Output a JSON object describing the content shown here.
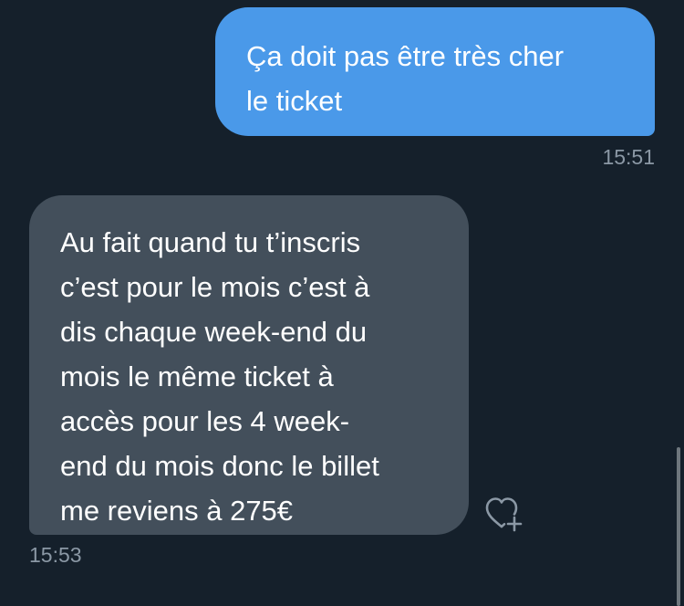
{
  "conversation": {
    "messages": [
      {
        "direction": "outgoing",
        "lines": [
          "Ça doit pas être très cher",
          "le ticket"
        ],
        "timestamp": "15:51"
      },
      {
        "direction": "incoming",
        "lines": [
          "Au fait quand tu t’inscris",
          "c’est pour le mois c’est à",
          "dis chaque week-end du",
          "mois le même ticket à",
          "accès pour les 4 week-",
          "end du mois donc le billet",
          "me reviens à 275€"
        ],
        "timestamp": "15:53",
        "reaction_icon": "heart-add-icon"
      }
    ]
  },
  "colors": {
    "background": "#15202b",
    "outgoing_bubble": "#4a99e9",
    "incoming_bubble": "#434f5b",
    "timestamp_text": "#8b98a5",
    "message_text": "#ffffff"
  }
}
